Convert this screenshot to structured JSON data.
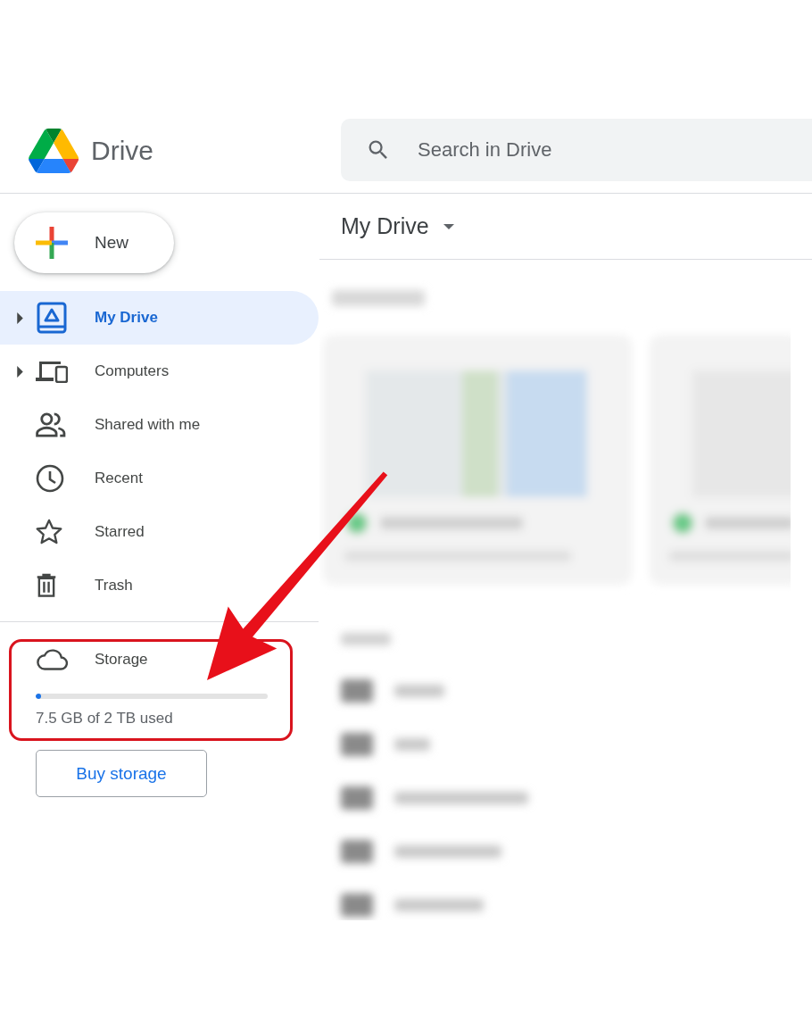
{
  "app": {
    "name": "Drive"
  },
  "search": {
    "placeholder": "Search in Drive"
  },
  "new_button": {
    "label": "New"
  },
  "nav": [
    {
      "label": "My Drive",
      "selected": true,
      "expandable": true
    },
    {
      "label": "Computers",
      "selected": false,
      "expandable": true
    },
    {
      "label": "Shared with me",
      "selected": false,
      "expandable": false
    },
    {
      "label": "Recent",
      "selected": false,
      "expandable": false
    },
    {
      "label": "Starred",
      "selected": false,
      "expandable": false
    },
    {
      "label": "Trash",
      "selected": false,
      "expandable": false
    }
  ],
  "storage": {
    "label": "Storage",
    "level": 0.004,
    "usage": "7.5 GB of 2 TB used",
    "highlighted": true
  },
  "buy_button": {
    "label": "Buy storage"
  },
  "main": {
    "title": "My Drive"
  }
}
